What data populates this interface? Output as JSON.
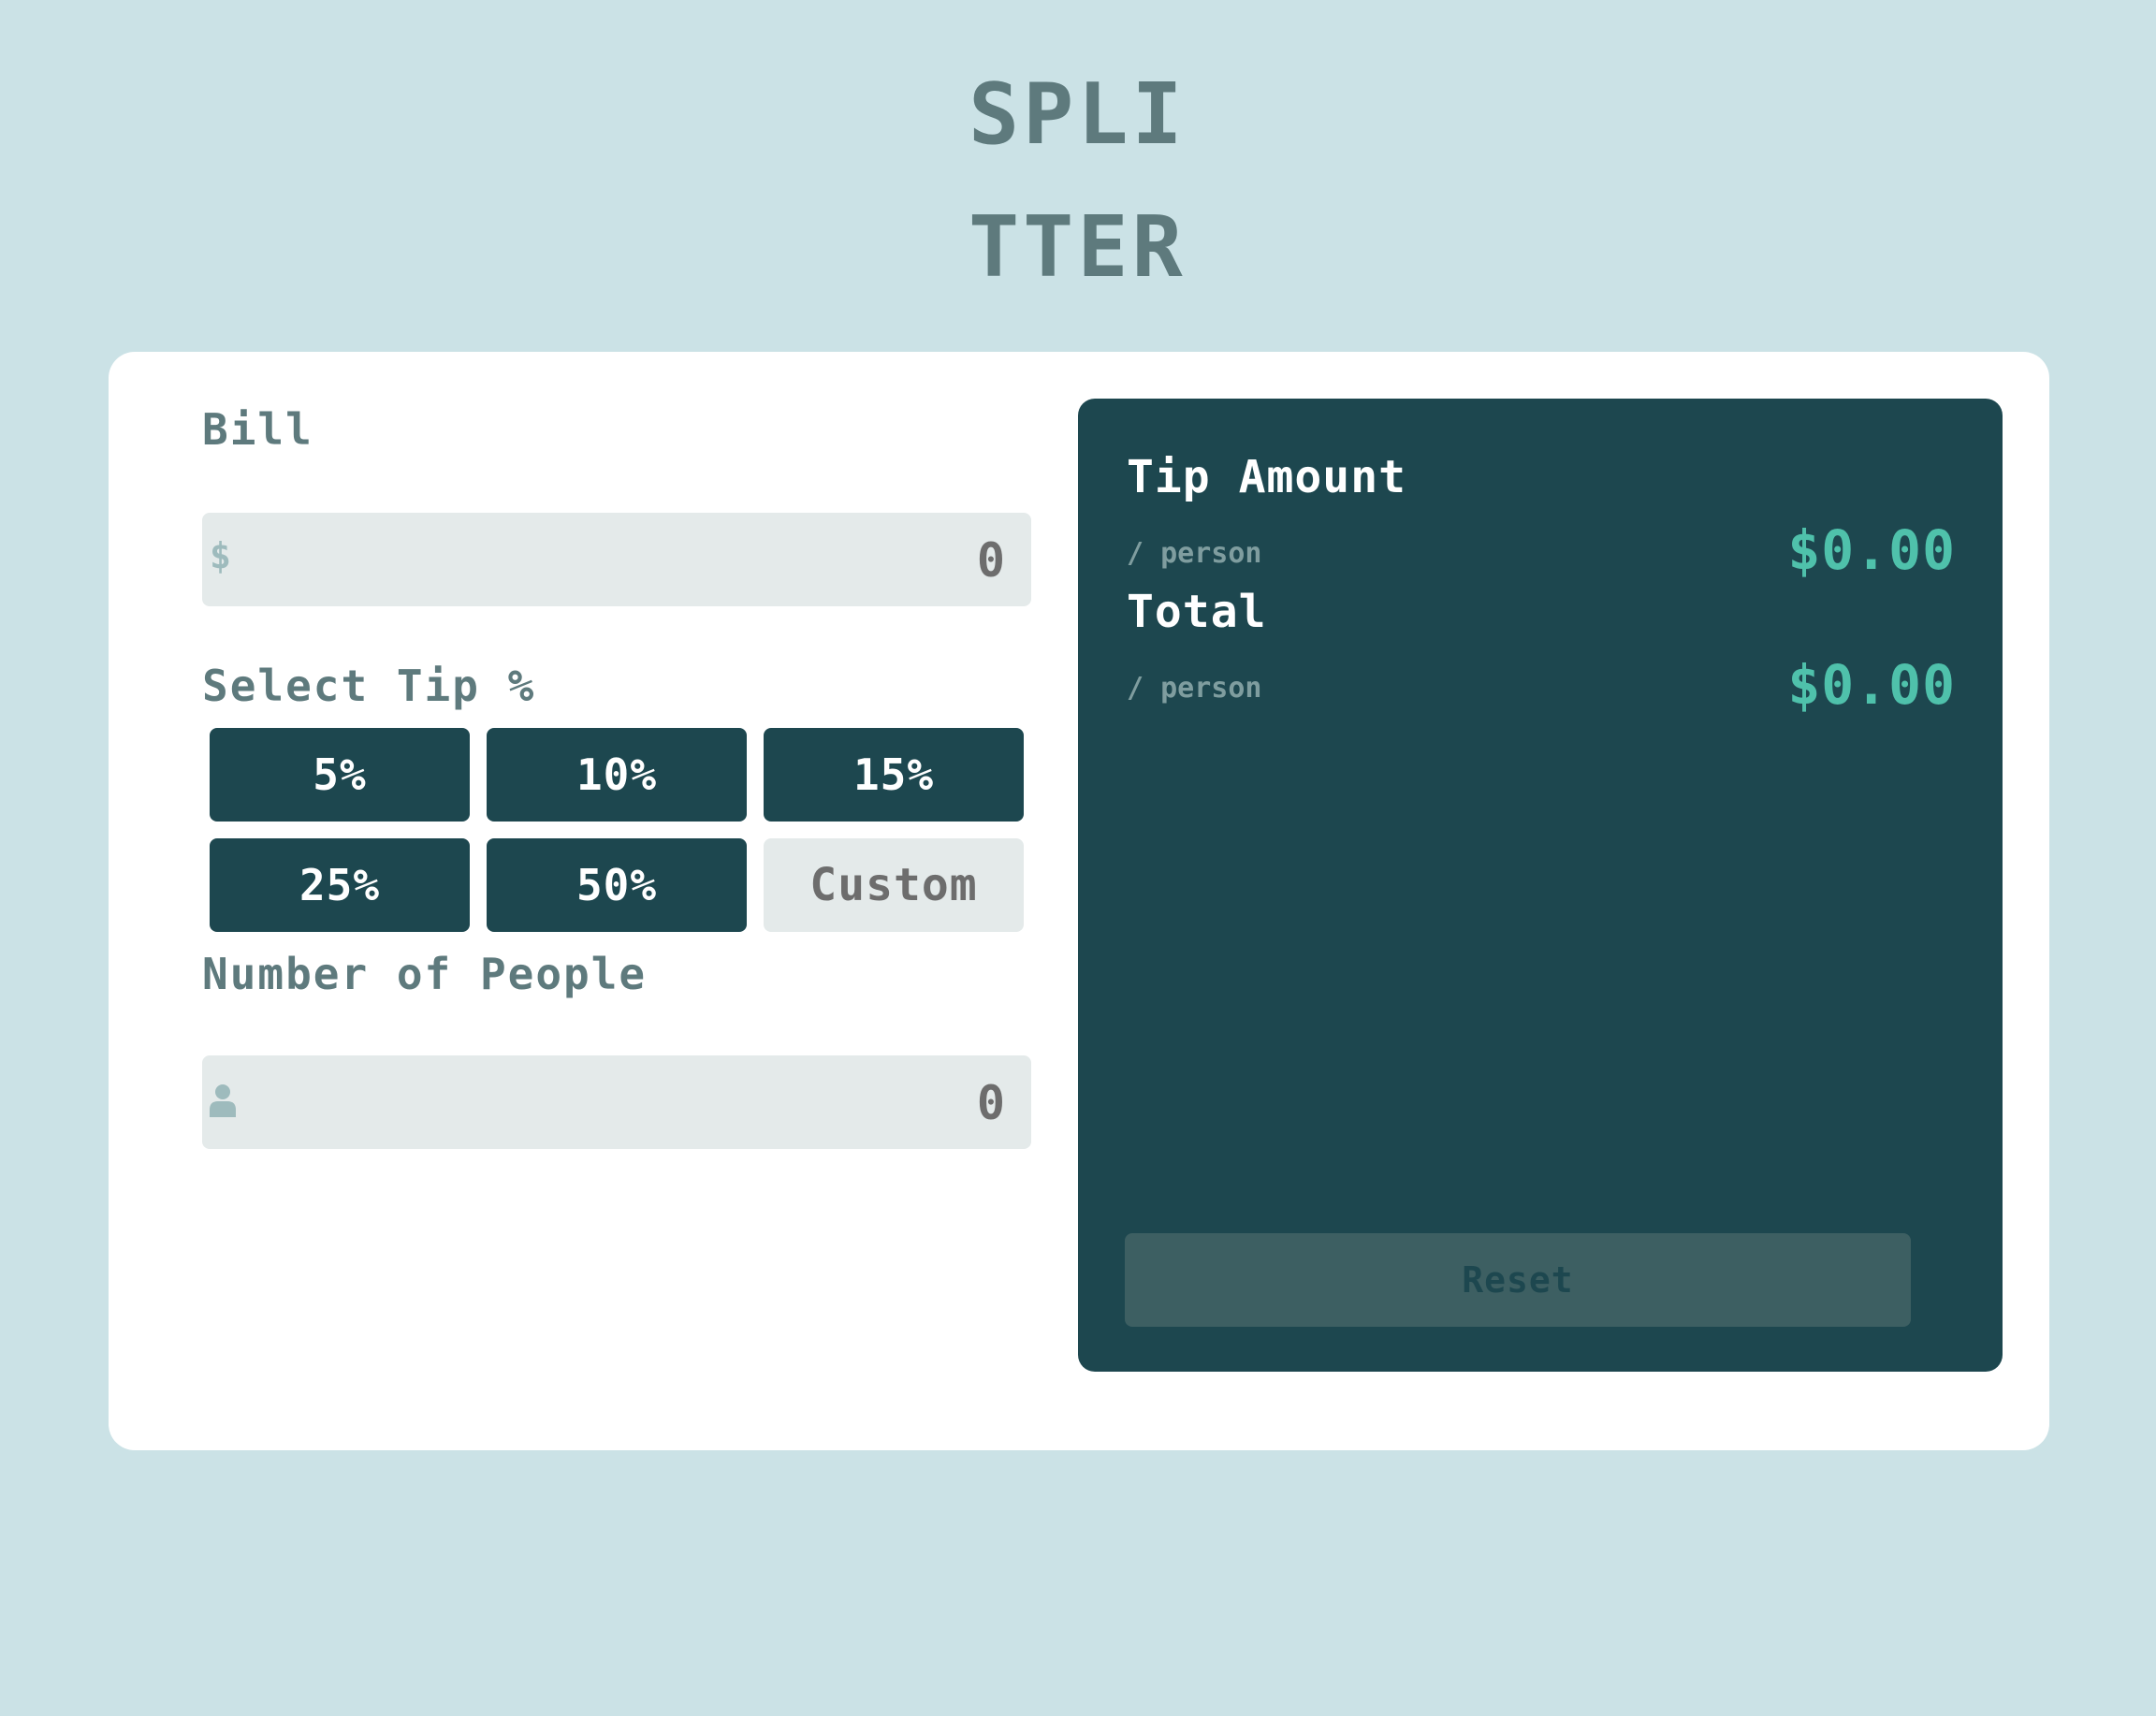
{
  "app": {
    "logo_line1": "SPLI",
    "logo_line2": "TTER"
  },
  "form": {
    "bill_label": "Bill",
    "bill_prefix": "$",
    "bill_value": "0",
    "tip_label": "Select Tip %",
    "tip_options": [
      "5%",
      "10%",
      "15%",
      "25%",
      "50%"
    ],
    "custom_label": "Custom",
    "people_label": "Number of People",
    "people_icon": "person-icon",
    "people_value": "0"
  },
  "results": {
    "tip_title": "Tip Amount",
    "tip_sub": "/ person",
    "tip_value": "$0.00",
    "total_title": "Total",
    "total_sub": "/ person",
    "total_value": "$0.00",
    "reset_label": "Reset"
  },
  "colors": {
    "background": "#cbe2e6",
    "dark_teal": "#1d474f",
    "accent": "#4fc1ab",
    "label": "#5e7a7d",
    "input_bg": "#e4eaea"
  }
}
